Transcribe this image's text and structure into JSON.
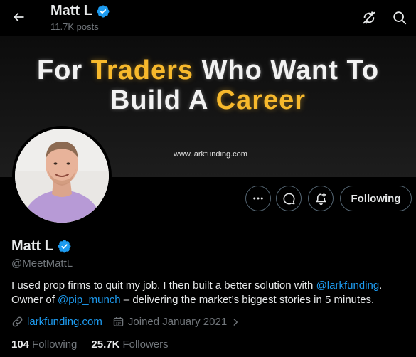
{
  "header": {
    "name": "Matt L",
    "posts_count": "11.7K posts",
    "back_icon": "arrow-left-icon",
    "actions": [
      {
        "icon": "sync-slash-icon"
      },
      {
        "icon": "search-icon"
      }
    ]
  },
  "banner": {
    "line1_white_a": "For ",
    "line1_accent": "Traders",
    "line1_white_b": " Who Want To",
    "line2_white": "Build A ",
    "line2_accent": "Career",
    "url": "www.larkfunding.com",
    "accent_color": "#f7b92c"
  },
  "profile": {
    "name": "Matt L",
    "handle": "@MeetMattL",
    "verified_color": "#1d9bf0",
    "bio": {
      "part1": "I used prop firms to quit my job. I then built a better solution with ",
      "mention1": "@larkfunding",
      "part2": ". Owner of ",
      "mention2": "@pip_munch",
      "part3": " – delivering the market’s biggest stories in 5 minutes."
    },
    "website": "larkfunding.com",
    "joined": "Joined January 2021",
    "following_count": "104",
    "following_label": "Following",
    "followers_count": "25.7K",
    "followers_label": "Followers"
  },
  "actions": {
    "more_icon": "more-icon",
    "message_icon": "message-icon",
    "notify_icon": "bell-plus-icon",
    "following_button": "Following"
  }
}
